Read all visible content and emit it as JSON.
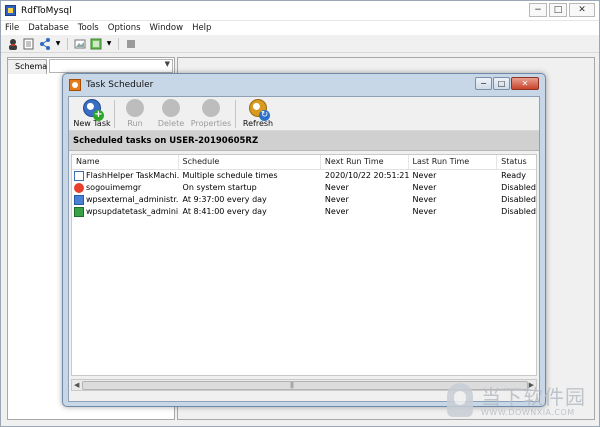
{
  "app": {
    "title": "RdfToMysql",
    "window_controls": [
      "−",
      "□",
      "✕"
    ]
  },
  "menu": [
    "File",
    "Database",
    "Tools",
    "Options",
    "Window",
    "Help"
  ],
  "toolbar_icons": [
    "user-icon",
    "properties-icon",
    "network-icon",
    "dropdown-arrow-icon",
    "image-icon",
    "green-box-icon",
    "dropdown-arrow-icon",
    "stop-icon"
  ],
  "left_pane": {
    "tab": "Schema",
    "select_value": ""
  },
  "dialog": {
    "title": "Task Scheduler",
    "controls": [
      "−",
      "□",
      "✕"
    ],
    "toolbar": [
      {
        "label": "New Task",
        "enabled": true,
        "icon": "new-task-icon"
      },
      {
        "label": "Run",
        "enabled": false,
        "icon": "run-icon"
      },
      {
        "label": "Delete",
        "enabled": false,
        "icon": "delete-icon"
      },
      {
        "label": "Properties",
        "enabled": false,
        "icon": "properties-icon"
      },
      {
        "label": "Refresh",
        "enabled": true,
        "icon": "refresh-icon"
      }
    ],
    "scheduled_heading": "Scheduled tasks on USER-20190605RZ",
    "columns": [
      "Name",
      "Schedule",
      "Next Run Time",
      "Last Run Time",
      "Status"
    ],
    "rows": [
      {
        "icon": "flash-icon",
        "name": "FlashHelper TaskMachi...",
        "schedule": "Multiple schedule times",
        "next": "2020/10/22 20:51:21",
        "last": "Never",
        "status": "Ready"
      },
      {
        "icon": "sogou-icon",
        "name": "sogouimemgr",
        "schedule": "On system startup",
        "next": "Never",
        "last": "Never",
        "status": "Disabled"
      },
      {
        "icon": "wps-icon",
        "name": "wpsexternal_administr...",
        "schedule": "At 9:37:00 every day",
        "next": "Never",
        "last": "Never",
        "status": "Disabled"
      },
      {
        "icon": "update-icon",
        "name": "wpsupdatetask_admini...",
        "schedule": "At 8:41:00 every day",
        "next": "Never",
        "last": "Never",
        "status": "Disabled"
      }
    ]
  },
  "watermark": {
    "cn": "当下软件园",
    "en": "WWW.DOWNXIA.COM"
  },
  "colors": {
    "dialog_frame": "#c7d7e8",
    "heading_band": "#d0d0d0",
    "window_bg": "#f0f0f0"
  }
}
